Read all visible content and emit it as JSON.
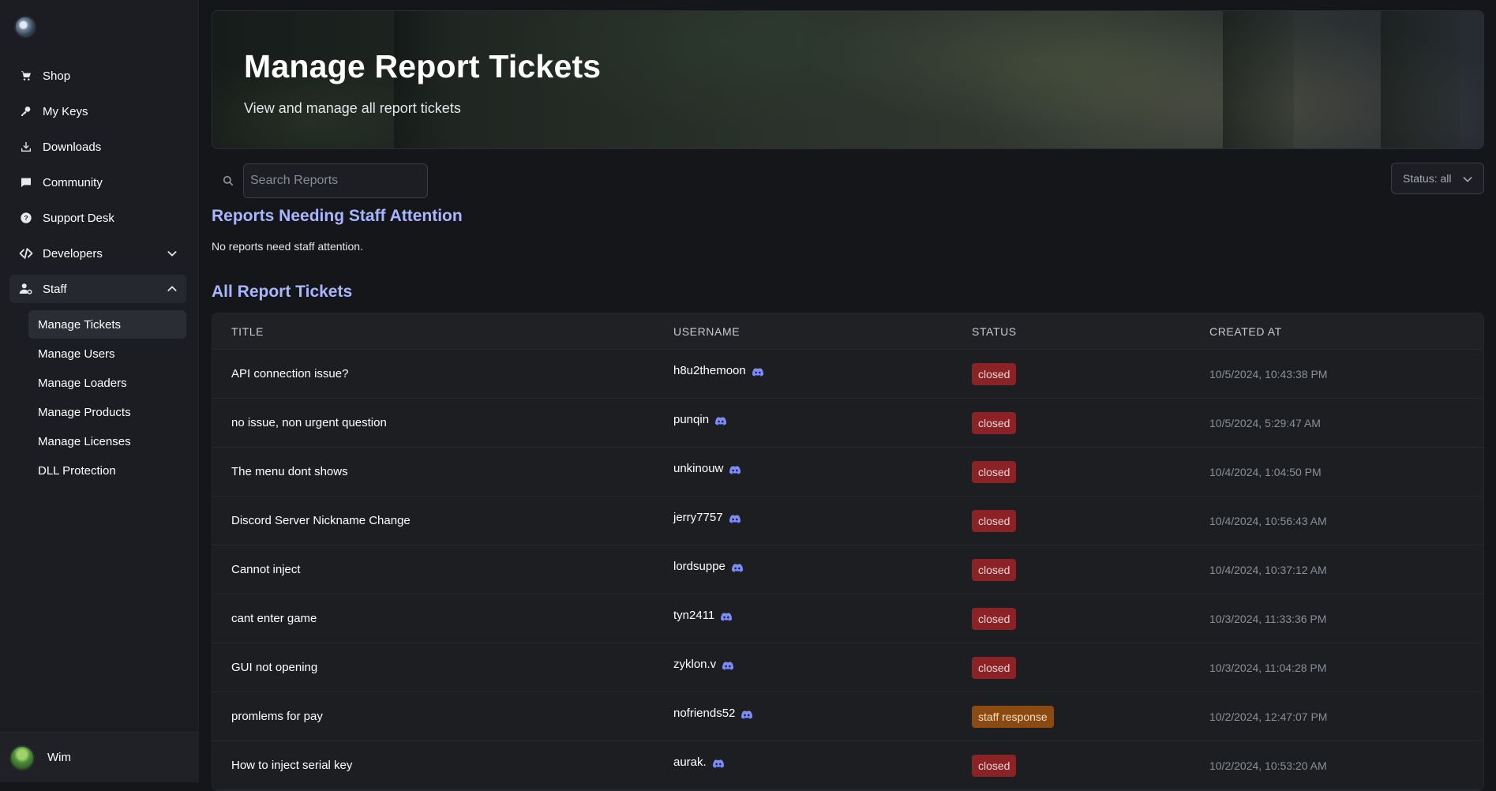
{
  "sidebar": {
    "items": [
      {
        "label": "Shop",
        "icon": "cart-icon"
      },
      {
        "label": "My Keys",
        "icon": "key-icon"
      },
      {
        "label": "Downloads",
        "icon": "download-icon"
      },
      {
        "label": "Community",
        "icon": "chat-icon"
      },
      {
        "label": "Support Desk",
        "icon": "help-icon"
      },
      {
        "label": "Developers",
        "icon": "code-icon"
      },
      {
        "label": "Staff",
        "icon": "staff-icon"
      }
    ],
    "staff_sub": [
      "Manage Tickets",
      "Manage Users",
      "Manage Loaders",
      "Manage Products",
      "Manage Licenses",
      "DLL Protection"
    ],
    "user": "Wim"
  },
  "banner": {
    "title": "Manage Report Tickets",
    "subtitle": "View and manage all report tickets"
  },
  "search": {
    "placeholder": "Search Reports"
  },
  "status_filter": {
    "label": "Status: all"
  },
  "attention": {
    "title": "Reports Needing Staff Attention",
    "empty": "No reports need staff attention."
  },
  "all": {
    "title": "All Report Tickets",
    "columns": [
      "TITLE",
      "USERNAME",
      "STATUS",
      "CREATED AT"
    ],
    "rows": [
      {
        "title": "API connection issue?",
        "username": "h8u2themoon",
        "status": "closed",
        "created": "10/5/2024, 10:43:38 PM"
      },
      {
        "title": "no issue, non urgent question",
        "username": "punqin",
        "status": "closed",
        "created": "10/5/2024, 5:29:47 AM"
      },
      {
        "title": "The menu dont shows",
        "username": "unkinouw",
        "status": "closed",
        "created": "10/4/2024, 1:04:50 PM"
      },
      {
        "title": "Discord Server Nickname Change",
        "username": "jerry7757",
        "status": "closed",
        "created": "10/4/2024, 10:56:43 AM"
      },
      {
        "title": "Cannot inject",
        "username": "lordsuppe",
        "status": "closed",
        "created": "10/4/2024, 10:37:12 AM"
      },
      {
        "title": "cant enter game",
        "username": "tyn2411",
        "status": "closed",
        "created": "10/3/2024, 11:33:36 PM"
      },
      {
        "title": "GUI not opening",
        "username": "zyklon.v",
        "status": "closed",
        "created": "10/3/2024, 11:04:28 PM"
      },
      {
        "title": "promlems for pay",
        "username": "nofriends52",
        "status": "staff response",
        "created": "10/2/2024, 12:47:07 PM"
      },
      {
        "title": "How to inject serial key",
        "username": "aurak.",
        "status": "closed",
        "created": "10/2/2024, 10:53:20 AM"
      }
    ]
  },
  "colors": {
    "accent": "#a8b6ff",
    "closed": "#8a2226",
    "staff_response": "#8a4a12",
    "discord": "#7b8cff"
  }
}
